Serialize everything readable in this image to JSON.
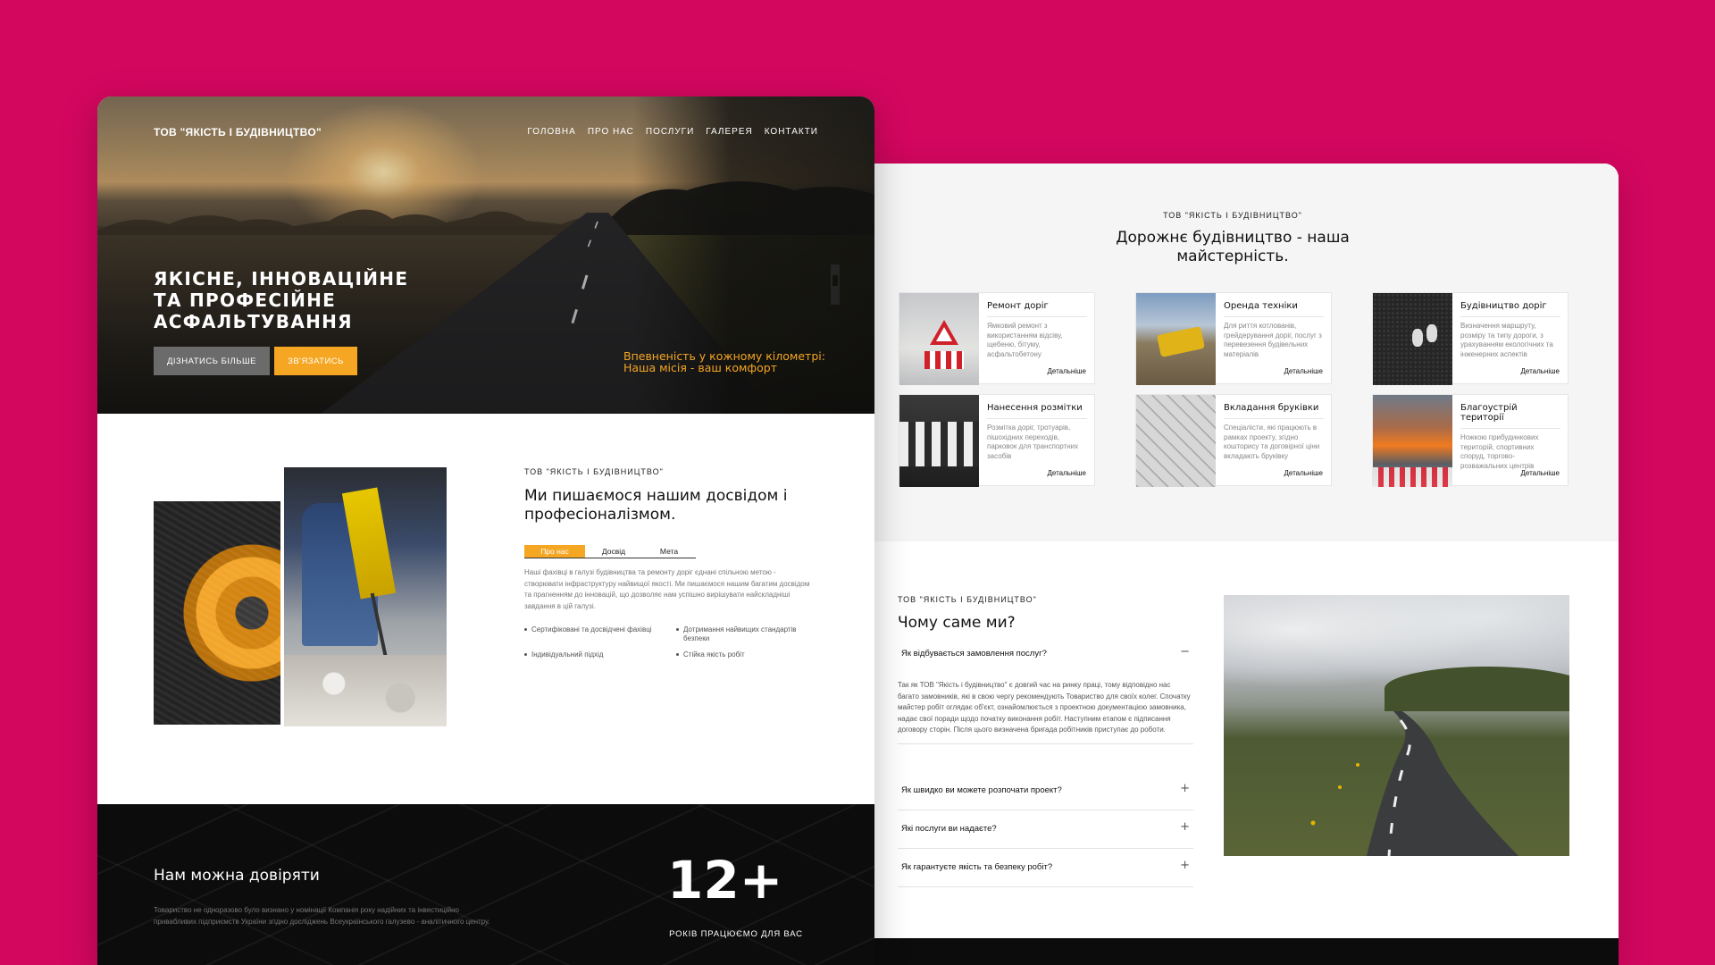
{
  "site": {
    "logo": "ТОВ \"ЯКІСТЬ І БУДІВНИЦТВО\"",
    "nav": [
      "ГОЛОВНА",
      "ПРО НАС",
      "ПОСЛУГИ",
      "ГАЛЕРЕЯ",
      "КОНТАКТИ"
    ]
  },
  "hero": {
    "title": "ЯКІСНЕ, ІННОВАЦІЙНЕ\nТА ПРОФЕСІЙНЕ\nАСФАЛЬТУВАННЯ",
    "btn_more": "ДІЗНАТИСЬ БІЛЬШЕ",
    "btn_contact": "ЗВ'ЯЗАТИСЬ",
    "tagline": "Впевненість у кожному кілометрі:\nНаша місія - ваш комфорт"
  },
  "about": {
    "eyebrow": "ТОВ \"ЯКІСТЬ І БУДІВНИЦТВО\"",
    "title": "Ми пишаємося нашим досвідом і професіоналізмом.",
    "tabs": [
      "Про нас",
      "Досвід",
      "Мета"
    ],
    "text": "Наші фахівці в галузі будівництва та ремонту доріг єднані спільною метою - створювати інфраструктуру найвищої якості. Ми пишаємося нашим багатим досвідом та прагненням до інновацій, що дозволяє нам успішно вирішувати найскладніші завдання в цій галузі.",
    "bullets": [
      "Сертифіковані та досвідчені фахівці",
      "Дотримання найвищих стандартів безпеки",
      "Індивідуальний підхід",
      "Стійка якість робіт"
    ]
  },
  "trust": {
    "title": "Нам можна довіряти",
    "text": "Товариство не одноразово було визнано у номінації Компанія року надійних та інвестиційно привабливих підприємств України згідно досліджень Всеукраїнського галузево - аналітичного центру.",
    "stat_number": "12+",
    "stat_label": "РОКІВ ПРАЦЮЄМО ДЛЯ ВАС"
  },
  "services": {
    "eyebrow": "ТОВ \"ЯКІСТЬ І БУДІВНИЦТВО\"",
    "title": "Дорожнє будівництво - наша майстерність.",
    "more_label": "Детальніше",
    "items": [
      {
        "name": "Ремонт доріг",
        "desc": "Ямковий ремонт з використанням відсіву, щебеню, бітуму, асфальтобетону"
      },
      {
        "name": "Оренда техніки",
        "desc": "Для риття котлованів, грейдерування доріг, послуг з перевезення будівельних матеріалів"
      },
      {
        "name": "Будівництво доріг",
        "desc": "Визначення маршруту, розміру та типу дороги, з урахуванням екологічних та інженерних аспектів"
      },
      {
        "name": "Нанесення розмітки",
        "desc": "Розмітка доріг, тротуарів, пішохідних переходів, парковок для транспортних засобів"
      },
      {
        "name": "Вкладання бруківки",
        "desc": "Спеціалісти, які працюють в рамках проекту, згідно кошторису та договірної ціни вкладають бруківку"
      },
      {
        "name": "Благоустрій території",
        "desc": "Ножкою прибудинкових територій, спортивних споруд, торгово-розважальних центрів"
      }
    ]
  },
  "faq": {
    "eyebrow": "ТОВ \"ЯКІСТЬ І БУДІВНИЦТВО\"",
    "title": "Чому саме ми?",
    "items": [
      {
        "q": "Як відбувається замовлення послуг?",
        "sign": "−",
        "a": "Так як ТОВ \"Якість і будівництво\" є довгий час на ринку праці, тому відповідно нас багато замовників, які в свою чергу рекомендують Товариство для своїх колег. Спочатку майстер робіт оглядає об'єкт, ознайомлюється з проектною документацією замовника, надає свої поради щодо початку виконання робіт. Наступним етапом є підписання договору сторін. Після цього визначена бригада робітників приступає до роботи."
      },
      {
        "q": "Як швидко ви можете розпочати проект?",
        "sign": "+"
      },
      {
        "q": "Які послуги ви надаєте?",
        "sign": "+"
      },
      {
        "q": "Як гарантуєте якість та безпеку робіт?",
        "sign": "+"
      }
    ]
  },
  "colors": {
    "accent": "#f5a623",
    "background": "#d4075f",
    "dark": "#0c0c0c"
  }
}
